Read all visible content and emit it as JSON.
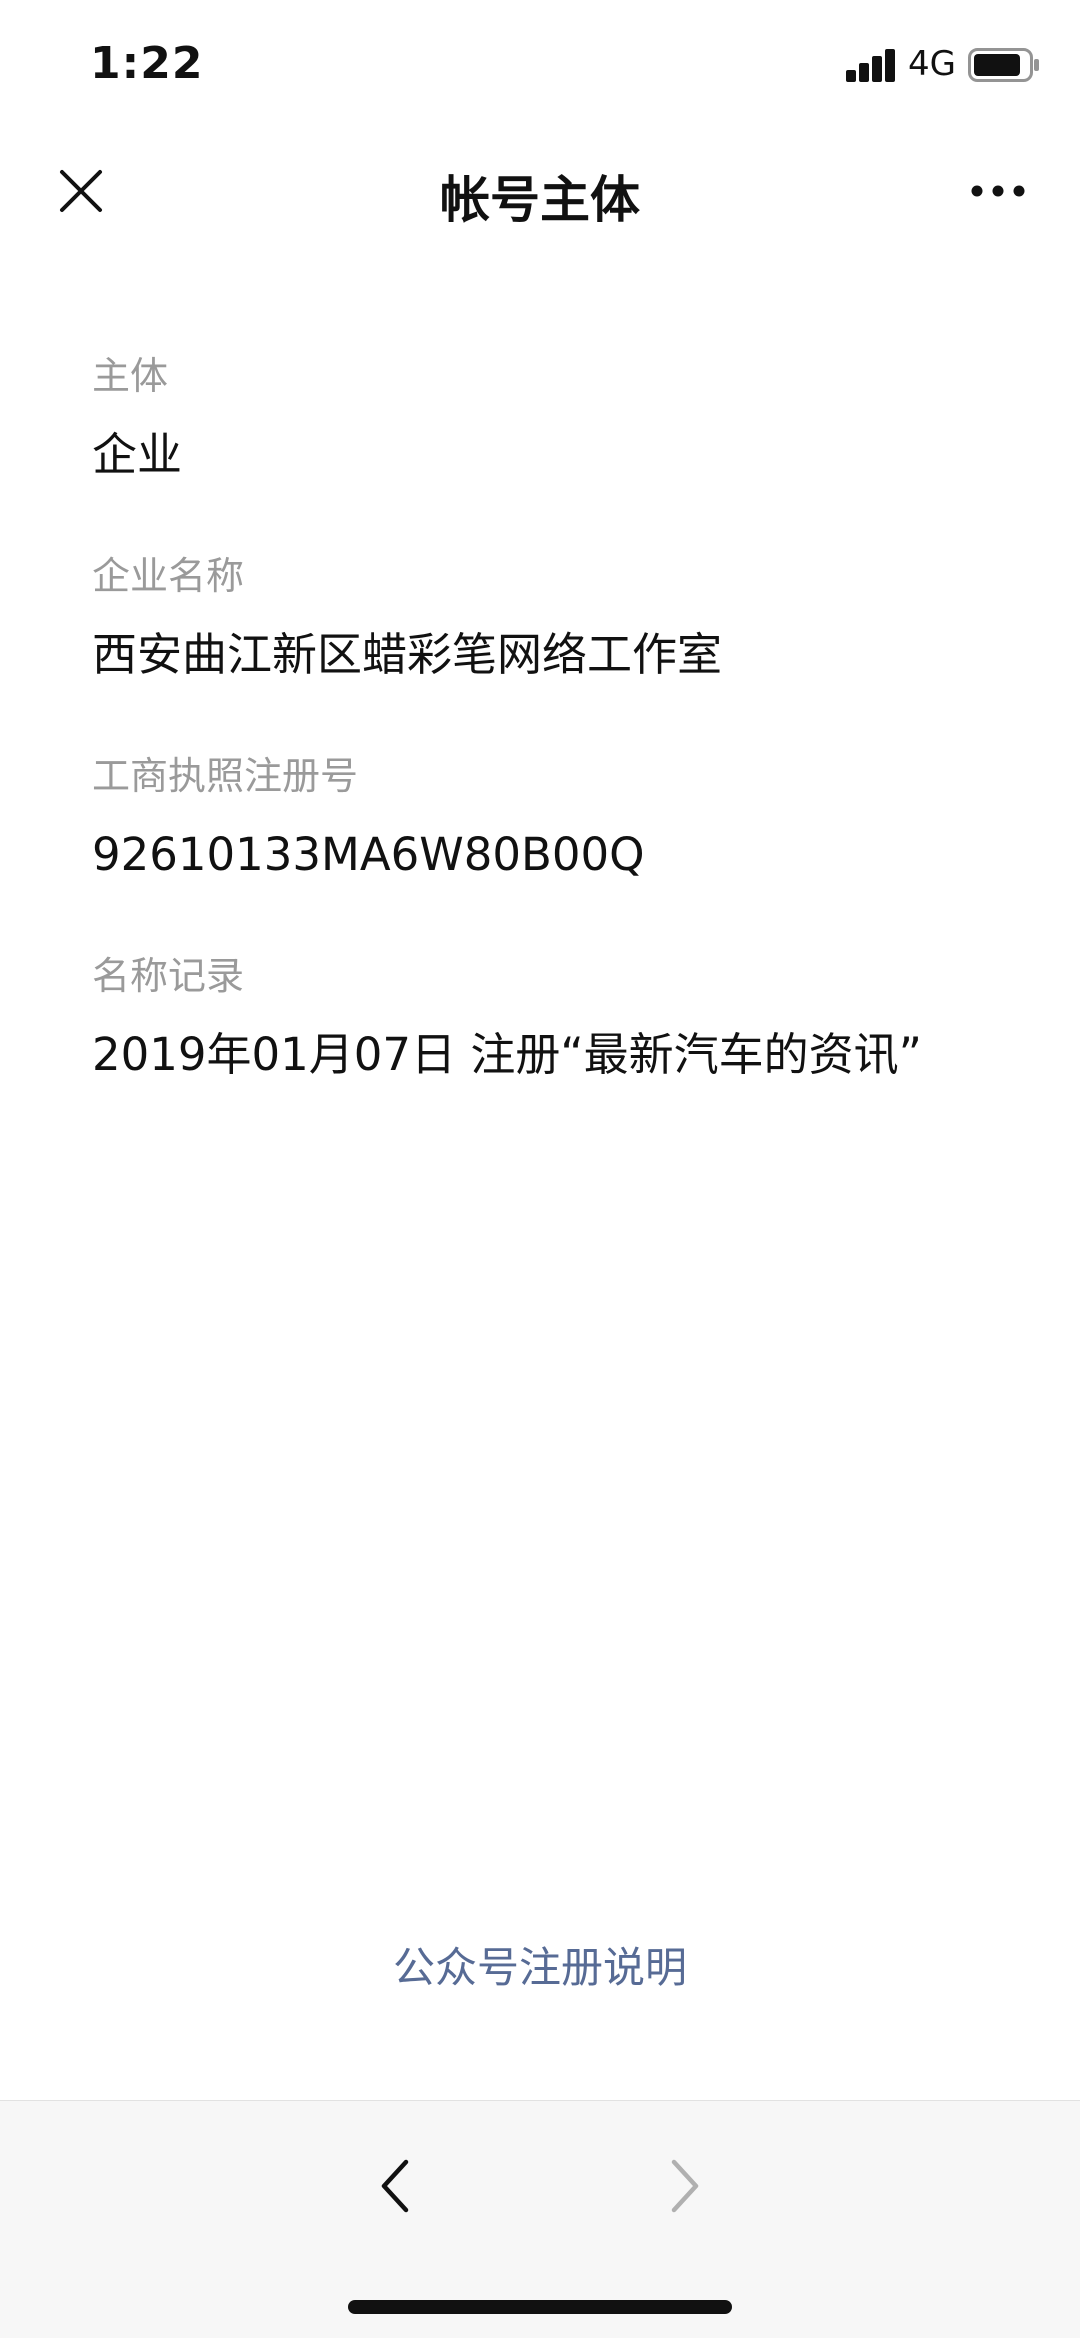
{
  "status_bar": {
    "time": "1:22",
    "network": "4G",
    "signal_icon": "cellular-signal-icon",
    "battery_icon": "battery-icon"
  },
  "nav": {
    "title": "帐号主体",
    "close_icon": "close-icon",
    "more_icon": "more-dots-icon"
  },
  "fields": [
    {
      "label": "主体",
      "value": "企业"
    },
    {
      "label": "企业名称",
      "value": "西安曲江新区蜡彩笔网络工作室"
    },
    {
      "label": "工商执照注册号",
      "value": "92610133MA6W80B00Q"
    },
    {
      "label": "名称记录",
      "value": "2019年01月07日 注册“最新汽车的资讯”"
    }
  ],
  "footer": {
    "link_text": "公众号注册说明"
  },
  "toolbar": {
    "back_icon": "chevron-left-icon",
    "forward_icon": "chevron-right-icon"
  },
  "colors": {
    "label": "#9a9a9a",
    "link": "#576b95",
    "toolbar_bg": "#f7f7f7"
  }
}
